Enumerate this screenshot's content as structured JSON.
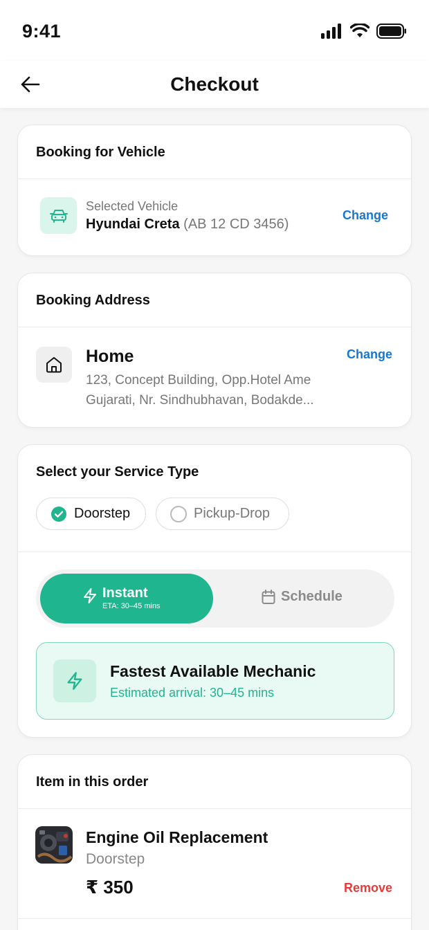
{
  "status_bar": {
    "time": "9:41"
  },
  "header": {
    "title": "Checkout"
  },
  "vehicle": {
    "section_title": "Booking for Vehicle",
    "label": "Selected Vehicle",
    "name": "Hyundai Creta",
    "plate": "(AB 12 CD 3456)",
    "change_label": "Change"
  },
  "address": {
    "section_title": "Booking Address",
    "name": "Home",
    "line1": "123, Concept Building, Opp.Hotel Ame",
    "line2": "Gujarati, Nr. Sindhubhavan, Bodakde...",
    "change_label": "Change"
  },
  "service": {
    "section_title": "Select your Service Type",
    "options": [
      {
        "label": "Doorstep",
        "selected": true
      },
      {
        "label": "Pickup-Drop",
        "selected": false
      }
    ],
    "modes": {
      "instant_label": "Instant",
      "instant_eta": "ETA: 30–45 mins",
      "schedule_label": "Schedule",
      "active": "instant"
    },
    "info": {
      "title": "Fastest Available Mechanic",
      "subtitle": "Estimated arrival: 30–45 mins"
    }
  },
  "order": {
    "section_title": "Item in this order",
    "items": [
      {
        "name": "Engine Oil Replacement",
        "type": "Doorstep",
        "price": "₹ 350",
        "remove_label": "Remove"
      }
    ]
  },
  "colors": {
    "accent": "#1fb58f",
    "link": "#1677d2",
    "danger": "#e63b3b"
  },
  "icons": [
    "signal-icon",
    "wifi-icon",
    "battery-icon",
    "back-arrow-icon",
    "car-icon",
    "home-icon",
    "check-circle-icon",
    "radio-icon",
    "lightning-icon",
    "calendar-icon"
  ]
}
